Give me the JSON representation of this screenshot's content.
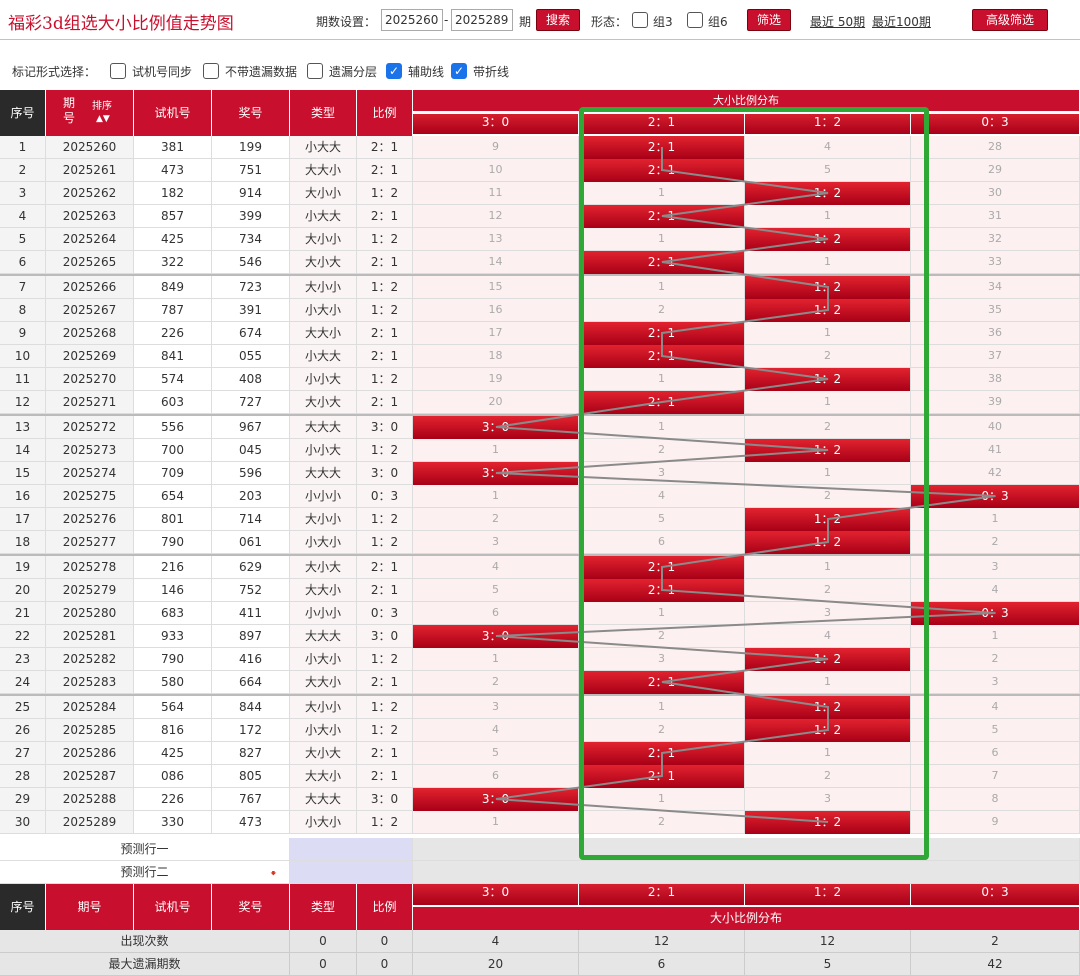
{
  "page_title": "福彩3d组选大小比例值走势图",
  "controls": {
    "period_label": "期数设置：",
    "from_value": "2025260",
    "dash": "-",
    "to_value": "2025289",
    "period_unit": "期",
    "search_label": "搜索",
    "form_label": "形态：",
    "group3_label": "组3",
    "group6_label": "组6",
    "filter_label": "筛选",
    "recent50_label": "最近 50期",
    "recent100_label": "最近100期",
    "advanced_label": "高级筛选"
  },
  "mark_options": {
    "label": "标记形式选择：",
    "items": [
      {
        "label": "试机号同步",
        "checked": false
      },
      {
        "label": "不带遗漏数据",
        "checked": false
      },
      {
        "label": "遗漏分层",
        "checked": false
      },
      {
        "label": "辅助线",
        "checked": true
      },
      {
        "label": "带折线",
        "checked": true
      }
    ]
  },
  "table_header": {
    "seq": "序号",
    "issue": "期号",
    "sort_label": "排序",
    "trial": "试机号",
    "prize": "奖号",
    "type": "类型",
    "ratio": "比例",
    "dist_title": "大小比例分布",
    "dist_cols": [
      "3：0",
      "2：1",
      "1：2",
      "0：3"
    ]
  },
  "rows": [
    {
      "seq": "1",
      "issue": "2025260",
      "trial": "381",
      "prize": "199",
      "type": "小大大",
      "ratio": "2：1",
      "miss": [
        "9",
        "",
        "4",
        "28"
      ]
    },
    {
      "seq": "2",
      "issue": "2025261",
      "trial": "473",
      "prize": "751",
      "type": "大大小",
      "ratio": "2：1",
      "miss": [
        "10",
        "",
        "5",
        "29"
      ]
    },
    {
      "seq": "3",
      "issue": "2025262",
      "trial": "182",
      "prize": "914",
      "type": "大小小",
      "ratio": "1：2",
      "miss": [
        "11",
        "1",
        "",
        "30"
      ]
    },
    {
      "seq": "4",
      "issue": "2025263",
      "trial": "857",
      "prize": "399",
      "type": "小大大",
      "ratio": "2：1",
      "miss": [
        "12",
        "",
        "1",
        "31"
      ]
    },
    {
      "seq": "5",
      "issue": "2025264",
      "trial": "425",
      "prize": "734",
      "type": "大小小",
      "ratio": "1：2",
      "miss": [
        "13",
        "1",
        "",
        "32"
      ]
    },
    {
      "seq": "6",
      "issue": "2025265",
      "trial": "322",
      "prize": "546",
      "type": "大小大",
      "ratio": "2：1",
      "miss": [
        "14",
        "",
        "1",
        "33"
      ]
    },
    {
      "seq": "7",
      "issue": "2025266",
      "trial": "849",
      "prize": "723",
      "type": "大小小",
      "ratio": "1：2",
      "miss": [
        "15",
        "1",
        "",
        "34"
      ]
    },
    {
      "seq": "8",
      "issue": "2025267",
      "trial": "787",
      "prize": "391",
      "type": "小大小",
      "ratio": "1：2",
      "miss": [
        "16",
        "2",
        "",
        "35"
      ]
    },
    {
      "seq": "9",
      "issue": "2025268",
      "trial": "226",
      "prize": "674",
      "type": "大大小",
      "ratio": "2：1",
      "miss": [
        "17",
        "",
        "1",
        "36"
      ]
    },
    {
      "seq": "10",
      "issue": "2025269",
      "trial": "841",
      "prize": "055",
      "type": "小大大",
      "ratio": "2：1",
      "miss": [
        "18",
        "",
        "2",
        "37"
      ]
    },
    {
      "seq": "11",
      "issue": "2025270",
      "trial": "574",
      "prize": "408",
      "type": "小小大",
      "ratio": "1：2",
      "miss": [
        "19",
        "1",
        "",
        "38"
      ]
    },
    {
      "seq": "12",
      "issue": "2025271",
      "trial": "603",
      "prize": "727",
      "type": "大小大",
      "ratio": "2：1",
      "miss": [
        "20",
        "",
        "1",
        "39"
      ]
    },
    {
      "seq": "13",
      "issue": "2025272",
      "trial": "556",
      "prize": "967",
      "type": "大大大",
      "ratio": "3：0",
      "miss": [
        "",
        "1",
        "2",
        "40"
      ]
    },
    {
      "seq": "14",
      "issue": "2025273",
      "trial": "700",
      "prize": "045",
      "type": "小小大",
      "ratio": "1：2",
      "miss": [
        "1",
        "2",
        "",
        "41"
      ]
    },
    {
      "seq": "15",
      "issue": "2025274",
      "trial": "709",
      "prize": "596",
      "type": "大大大",
      "ratio": "3：0",
      "miss": [
        "",
        "3",
        "1",
        "42"
      ]
    },
    {
      "seq": "16",
      "issue": "2025275",
      "trial": "654",
      "prize": "203",
      "type": "小小小",
      "ratio": "0：3",
      "miss": [
        "1",
        "4",
        "2",
        ""
      ]
    },
    {
      "seq": "17",
      "issue": "2025276",
      "trial": "801",
      "prize": "714",
      "type": "大小小",
      "ratio": "1：2",
      "miss": [
        "2",
        "5",
        "",
        "1"
      ]
    },
    {
      "seq": "18",
      "issue": "2025277",
      "trial": "790",
      "prize": "061",
      "type": "小大小",
      "ratio": "1：2",
      "miss": [
        "3",
        "6",
        "",
        "2"
      ]
    },
    {
      "seq": "19",
      "issue": "2025278",
      "trial": "216",
      "prize": "629",
      "type": "大小大",
      "ratio": "2：1",
      "miss": [
        "4",
        "",
        "1",
        "3"
      ]
    },
    {
      "seq": "20",
      "issue": "2025279",
      "trial": "146",
      "prize": "752",
      "type": "大大小",
      "ratio": "2：1",
      "miss": [
        "5",
        "",
        "2",
        "4"
      ]
    },
    {
      "seq": "21",
      "issue": "2025280",
      "trial": "683",
      "prize": "411",
      "type": "小小小",
      "ratio": "0：3",
      "miss": [
        "6",
        "1",
        "3",
        ""
      ]
    },
    {
      "seq": "22",
      "issue": "2025281",
      "trial": "933",
      "prize": "897",
      "type": "大大大",
      "ratio": "3：0",
      "miss": [
        "",
        "2",
        "4",
        "1"
      ]
    },
    {
      "seq": "23",
      "issue": "2025282",
      "trial": "790",
      "prize": "416",
      "type": "小大小",
      "ratio": "1：2",
      "miss": [
        "1",
        "3",
        "",
        "2"
      ]
    },
    {
      "seq": "24",
      "issue": "2025283",
      "trial": "580",
      "prize": "664",
      "type": "大大小",
      "ratio": "2：1",
      "miss": [
        "2",
        "",
        "1",
        "3"
      ]
    },
    {
      "seq": "25",
      "issue": "2025284",
      "trial": "564",
      "prize": "844",
      "type": "大小小",
      "ratio": "1：2",
      "miss": [
        "3",
        "1",
        "",
        "4"
      ]
    },
    {
      "seq": "26",
      "issue": "2025285",
      "trial": "816",
      "prize": "172",
      "type": "小大小",
      "ratio": "1：2",
      "miss": [
        "4",
        "2",
        "",
        "5"
      ]
    },
    {
      "seq": "27",
      "issue": "2025286",
      "trial": "425",
      "prize": "827",
      "type": "大小大",
      "ratio": "2：1",
      "miss": [
        "5",
        "",
        "1",
        "6"
      ]
    },
    {
      "seq": "28",
      "issue": "2025287",
      "trial": "086",
      "prize": "805",
      "type": "大大小",
      "ratio": "2：1",
      "miss": [
        "6",
        "",
        "2",
        "7"
      ]
    },
    {
      "seq": "29",
      "issue": "2025288",
      "trial": "226",
      "prize": "767",
      "type": "大大大",
      "ratio": "3：0",
      "miss": [
        "",
        "1",
        "3",
        "8"
      ]
    },
    {
      "seq": "30",
      "issue": "2025289",
      "trial": "330",
      "prize": "473",
      "type": "小大小",
      "ratio": "1：2",
      "miss": [
        "1",
        "2",
        "",
        "9"
      ]
    }
  ],
  "predict": {
    "row1": "预测行一",
    "row2": "预测行二"
  },
  "stats": {
    "appear_label": "出现次数",
    "appear": [
      "0",
      "0",
      "4",
      "12",
      "12",
      "2"
    ],
    "maxmiss_label": "最大遗漏期数",
    "maxmiss": [
      "0",
      "0",
      "20",
      "6",
      "5",
      "42"
    ]
  },
  "colors": {
    "brand_red": "#c8102e",
    "highlight_green": "#2fa836",
    "checkbox_blue": "#1a73e8"
  }
}
